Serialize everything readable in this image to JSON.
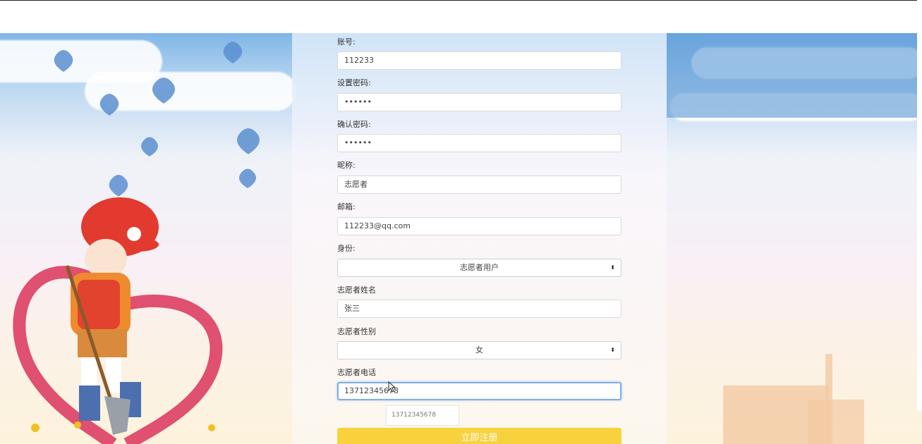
{
  "form": {
    "account": {
      "label": "账号:",
      "value": "112233"
    },
    "password": {
      "label": "设置密码:",
      "value": "••••••"
    },
    "confirm_password": {
      "label": "确认密码:",
      "value": "••••••"
    },
    "nickname": {
      "label": "昵称:",
      "value": "志愿者"
    },
    "email": {
      "label": "邮箱:",
      "value": "112233@qq.com"
    },
    "identity": {
      "label": "身份:",
      "selected": "志愿者用户"
    },
    "volunteer_name": {
      "label": "志愿者姓名",
      "value": "张三"
    },
    "volunteer_gender": {
      "label": "志愿者性别",
      "selected": "女"
    },
    "volunteer_phone": {
      "label": "志愿者电话",
      "value": "13712345678"
    },
    "autocomplete_suggestion": "13712345678",
    "submit_label": "立即注册"
  },
  "select_arrows": "⬍",
  "colors": {
    "submit_button": "#f8d23c",
    "focus_border": "#7fb0e6",
    "sky": "#7fb6e8"
  }
}
